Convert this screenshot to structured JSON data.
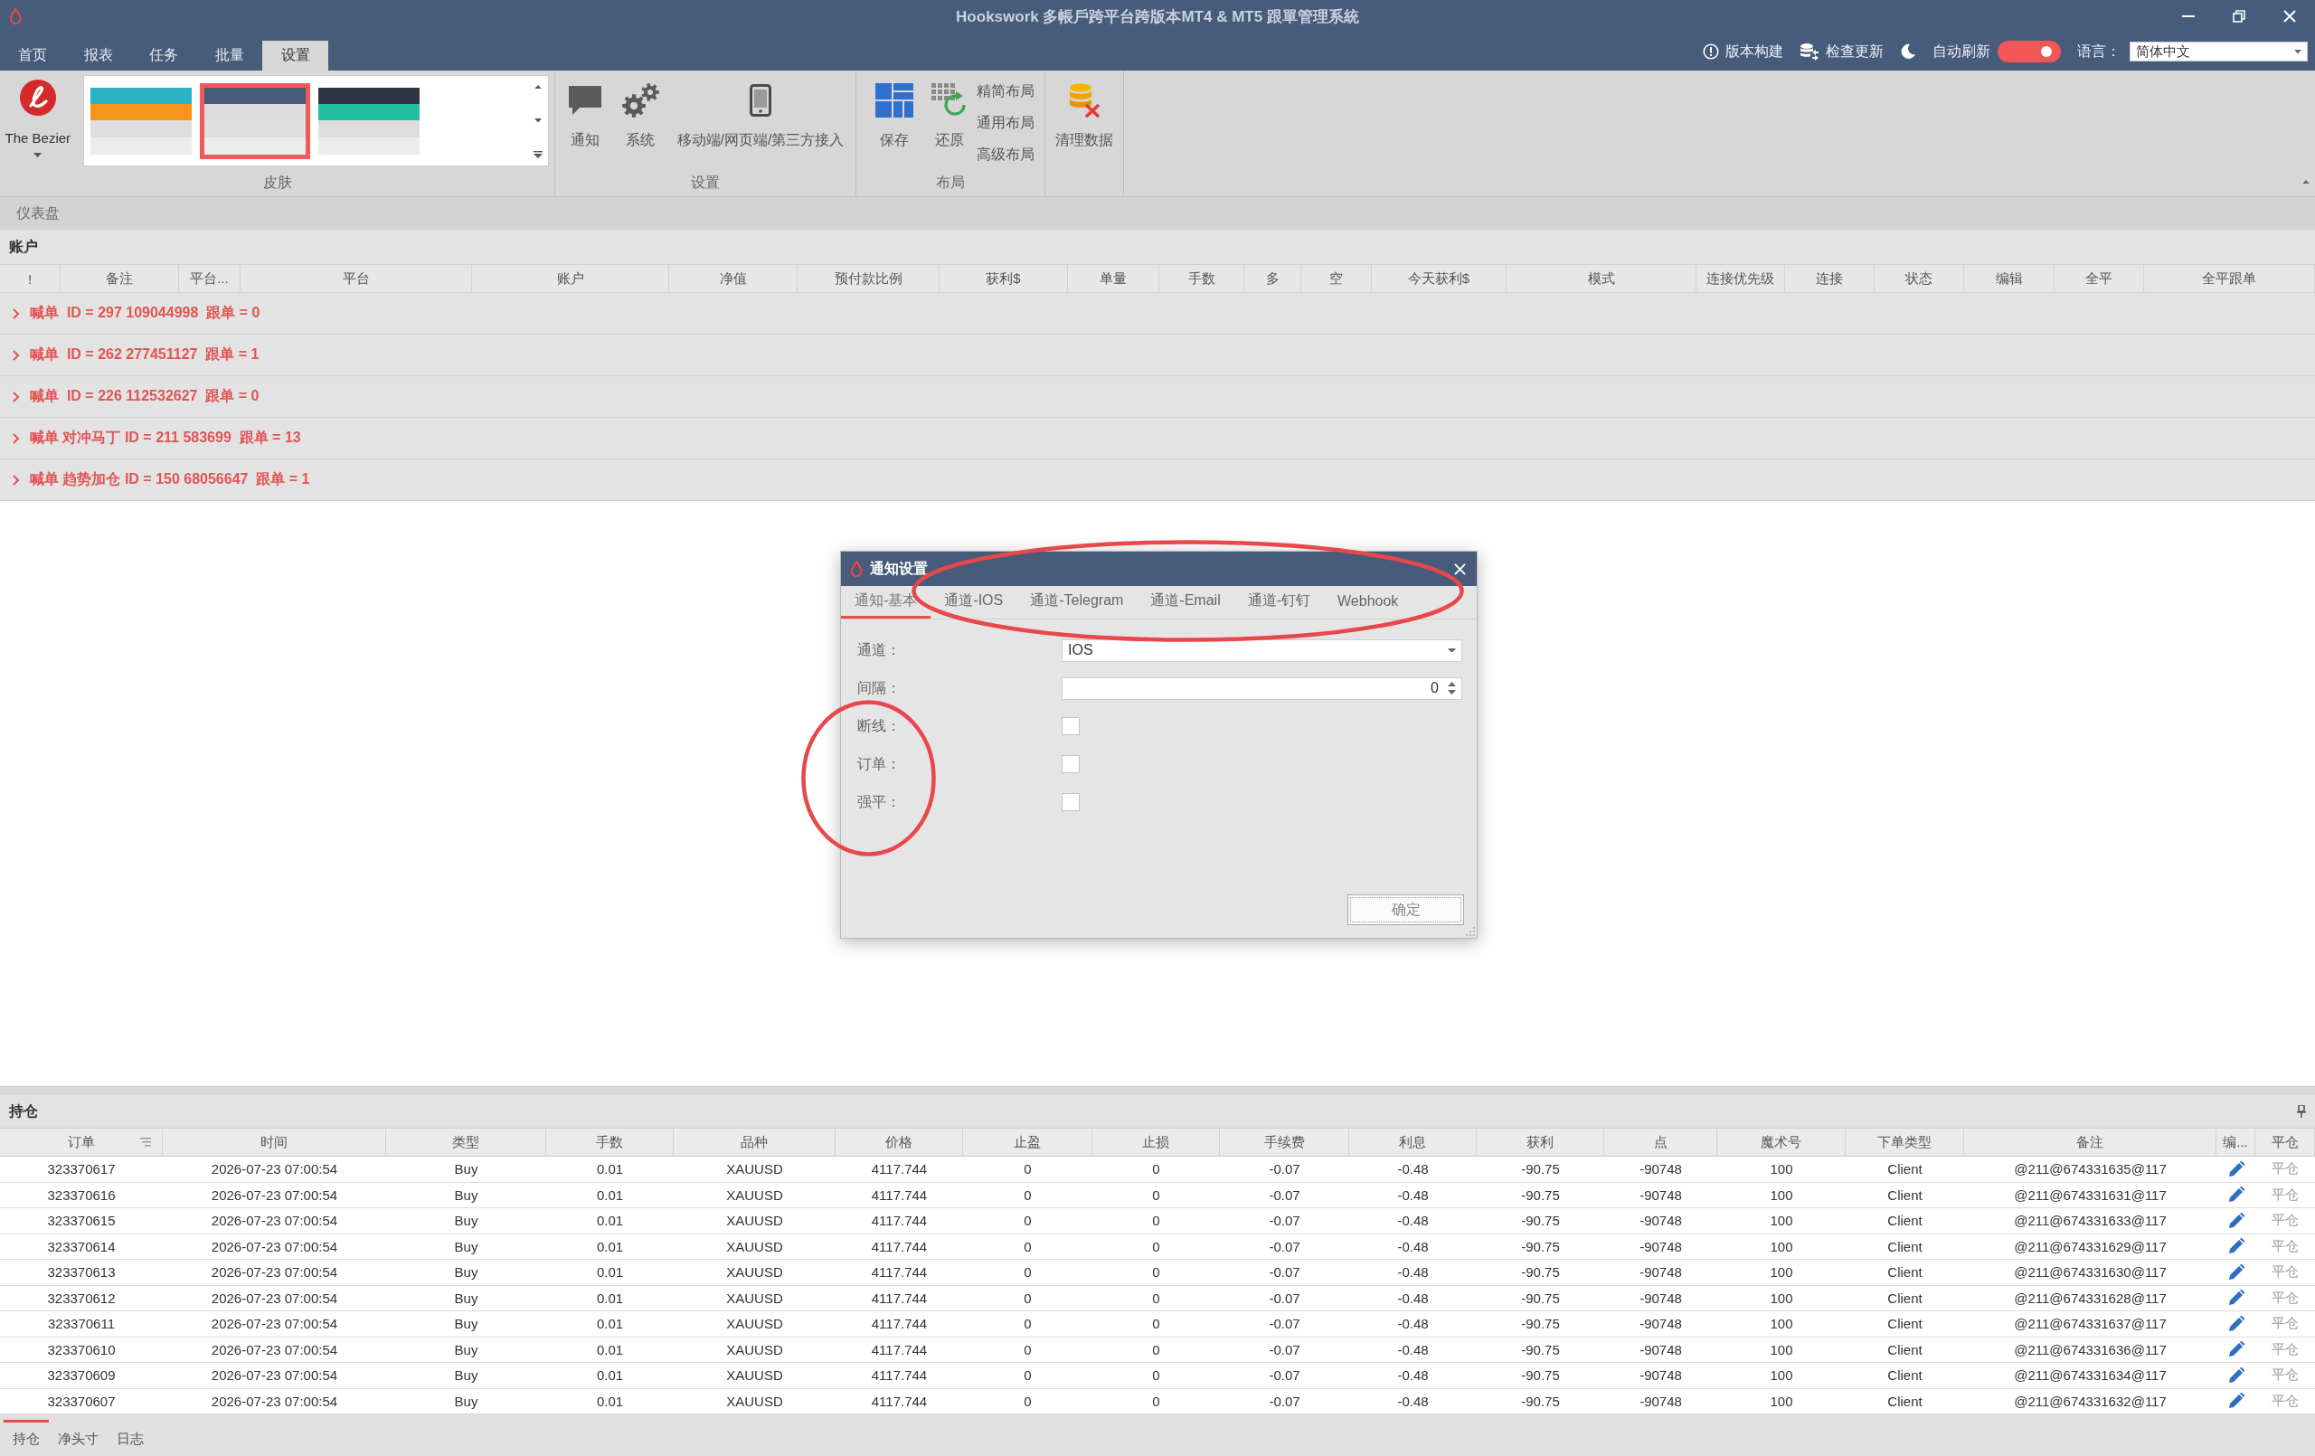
{
  "window": {
    "title": "Hookswork 多帳戶跨平台跨版本MT4 & MT5 跟單管理系統"
  },
  "menu_tabs": [
    {
      "label": "首页",
      "selected": false
    },
    {
      "label": "报表",
      "selected": false
    },
    {
      "label": "任务",
      "selected": false
    },
    {
      "label": "批量",
      "selected": false
    },
    {
      "label": "设置",
      "selected": true
    }
  ],
  "toolbar": {
    "version_button": "版本构建",
    "update_button": "检查更新",
    "auto_refresh": {
      "label": "自动刷新",
      "on": true
    },
    "language": {
      "label": "语言：",
      "value": "简体中文"
    }
  },
  "ribbon": {
    "groups": [
      {
        "kind": "gallery",
        "label": "皮肤",
        "theme": "The Bezier",
        "skins": [
          {
            "selected": false,
            "bands": [
              {
                "color": "#29b2c4"
              },
              {
                "color": "#f7941d"
              }
            ]
          },
          {
            "selected": true,
            "bands": [
              {
                "color": "#475b7a"
              },
              {
                "color": "#dcdcdc"
              }
            ]
          },
          {
            "selected": false,
            "bands": [
              {
                "color": "#2f3540"
              },
              {
                "color": "#1fbf9f"
              }
            ]
          }
        ]
      },
      {
        "kind": "buttons",
        "label": "设置",
        "buttons": [
          "通知",
          "系统",
          "移动端/网页端/第三方接入"
        ]
      },
      {
        "kind": "buttons",
        "label": "布局",
        "buttons": [
          "保存",
          "还原"
        ],
        "layout_options": [
          "精简布局",
          "通用布局",
          "高级布局"
        ]
      },
      {
        "kind": "buttons",
        "buttons": [
          "清理数据"
        ]
      }
    ]
  },
  "breadcrumb": "仪表盘",
  "accounts": {
    "title": "账户",
    "columns": [
      "!",
      "备注",
      "平台...",
      "平台",
      "账户",
      "净值",
      "预付款比例",
      "获利$",
      "单量",
      "手数",
      "多",
      "空",
      "今天获利$",
      "模式",
      "连接优先级",
      "连接",
      "状态",
      "编辑",
      "全平",
      "全平跟单"
    ],
    "groups": [
      {
        "text": "喊单  ID = 297 109044998  跟单 = 0",
        "expanded": false
      },
      {
        "text": "喊单  ID = 262 277451127  跟单 = 1",
        "expanded": false
      },
      {
        "text": "喊单  ID = 226 112532627  跟单 = 0",
        "expanded": false
      },
      {
        "text": "喊单 对冲马丁 ID = 211 583699  跟单 = 13",
        "expanded": false
      },
      {
        "text": "喊单 趋势加仓 ID = 150 68056647  跟单 = 1",
        "expanded": false
      }
    ]
  },
  "dialog": {
    "title": "通知设置",
    "tabs": [
      {
        "label": "通知-基本",
        "selected": true
      },
      {
        "label": "通道-IOS",
        "selected": false
      },
      {
        "label": "通道-Telegram",
        "selected": false
      },
      {
        "label": "通道-Email",
        "selected": false
      },
      {
        "label": "通道-钉钉",
        "selected": false
      },
      {
        "label": "Webhook",
        "selected": false
      }
    ],
    "fields": [
      {
        "kind": "select",
        "label": "通道：",
        "value": "IOS"
      },
      {
        "kind": "spin",
        "label": "间隔：",
        "value": "0"
      },
      {
        "kind": "checkbox",
        "label": "断线：",
        "checked": false
      },
      {
        "kind": "checkbox",
        "label": "订单：",
        "checked": false
      },
      {
        "kind": "checkbox",
        "label": "强平：",
        "checked": false
      }
    ],
    "ok_button": "确定",
    "annotations": [
      {
        "kind": "ellipse"
      },
      {
        "kind": "ellipse"
      }
    ]
  },
  "positions": {
    "title": "持仓",
    "columns": [
      "订单",
      "时间",
      "类型",
      "手数",
      "品种",
      "价格",
      "止盈",
      "止损",
      "手续费",
      "利息",
      "获利",
      "点",
      "魔术号",
      "下单类型",
      "备注",
      "编...",
      "平仓"
    ],
    "rows": [
      {
        "cells": [
          "323370617",
          "2026-07-23 07:00:54",
          "Buy",
          "0.01",
          "XAUUSD",
          "4117.744",
          "0",
          "0",
          "-0.07",
          "-0.48",
          "-90.75",
          "-90748",
          "100",
          "Client",
          "@211@674331635@117"
        ],
        "action": "平仓"
      },
      {
        "cells": [
          "323370616",
          "2026-07-23 07:00:54",
          "Buy",
          "0.01",
          "XAUUSD",
          "4117.744",
          "0",
          "0",
          "-0.07",
          "-0.48",
          "-90.75",
          "-90748",
          "100",
          "Client",
          "@211@674331631@117"
        ],
        "action": "平仓"
      },
      {
        "cells": [
          "323370615",
          "2026-07-23 07:00:54",
          "Buy",
          "0.01",
          "XAUUSD",
          "4117.744",
          "0",
          "0",
          "-0.07",
          "-0.48",
          "-90.75",
          "-90748",
          "100",
          "Client",
          "@211@674331633@117"
        ],
        "action": "平仓"
      },
      {
        "cells": [
          "323370614",
          "2026-07-23 07:00:54",
          "Buy",
          "0.01",
          "XAUUSD",
          "4117.744",
          "0",
          "0",
          "-0.07",
          "-0.48",
          "-90.75",
          "-90748",
          "100",
          "Client",
          "@211@674331629@117"
        ],
        "action": "平仓"
      },
      {
        "cells": [
          "323370613",
          "2026-07-23 07:00:54",
          "Buy",
          "0.01",
          "XAUUSD",
          "4117.744",
          "0",
          "0",
          "-0.07",
          "-0.48",
          "-90.75",
          "-90748",
          "100",
          "Client",
          "@211@674331630@117"
        ],
        "action": "平仓"
      },
      {
        "cells": [
          "323370612",
          "2026-07-23 07:00:54",
          "Buy",
          "0.01",
          "XAUUSD",
          "4117.744",
          "0",
          "0",
          "-0.07",
          "-0.48",
          "-90.75",
          "-90748",
          "100",
          "Client",
          "@211@674331628@117"
        ],
        "action": "平仓"
      },
      {
        "cells": [
          "323370611",
          "2026-07-23 07:00:54",
          "Buy",
          "0.01",
          "XAUUSD",
          "4117.744",
          "0",
          "0",
          "-0.07",
          "-0.48",
          "-90.75",
          "-90748",
          "100",
          "Client",
          "@211@674331637@117"
        ],
        "action": "平仓"
      },
      {
        "cells": [
          "323370610",
          "2026-07-23 07:00:54",
          "Buy",
          "0.01",
          "XAUUSD",
          "4117.744",
          "0",
          "0",
          "-0.07",
          "-0.48",
          "-90.75",
          "-90748",
          "100",
          "Client",
          "@211@674331636@117"
        ],
        "action": "平仓"
      },
      {
        "cells": [
          "323370609",
          "2026-07-23 07:00:54",
          "Buy",
          "0.01",
          "XAUUSD",
          "4117.744",
          "0",
          "0",
          "-0.07",
          "-0.48",
          "-90.75",
          "-90748",
          "100",
          "Client",
          "@211@674331634@117"
        ],
        "action": "平仓"
      },
      {
        "cells": [
          "323370607",
          "2026-07-23 07:00:54",
          "Buy",
          "0.01",
          "XAUUSD",
          "4117.744",
          "0",
          "0",
          "-0.07",
          "-0.48",
          "-90.75",
          "-90748",
          "100",
          "Client",
          "@211@674331632@117"
        ],
        "action": "平仓"
      }
    ]
  },
  "bottom_tabs": [
    {
      "label": "持仓",
      "selected": true
    },
    {
      "label": "净头寸",
      "selected": false
    },
    {
      "label": "日志",
      "selected": false
    }
  ]
}
